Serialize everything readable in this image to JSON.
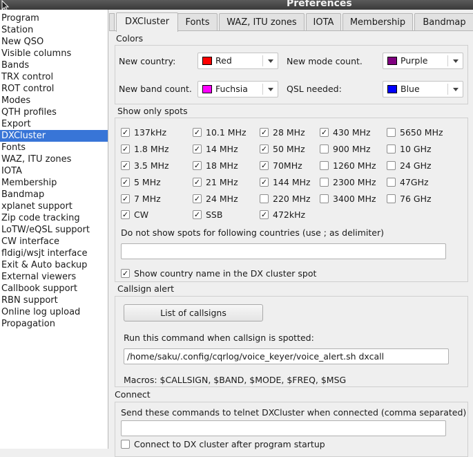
{
  "window": {
    "title": "Preferences"
  },
  "sidebar": {
    "selected": "DXCluster",
    "items": [
      "Program",
      "Station",
      "New QSO",
      "Visible columns",
      "Bands",
      "TRX control",
      "ROT control",
      "Modes",
      "QTH profiles",
      "Export",
      "DXCluster",
      "Fonts",
      "WAZ, ITU zones",
      "IOTA",
      "Membership",
      "Bandmap",
      "xplanet support",
      "Zip code tracking",
      "LoTW/eQSL support",
      "CW interface",
      "fldigi/wsjt interface",
      "Exit & Auto backup",
      "External viewers",
      "Callbook support",
      "RBN support",
      "Online log upload",
      "Propagation"
    ]
  },
  "tabs": [
    "DXCluster",
    "Fonts",
    "WAZ, ITU zones",
    "IOTA",
    "Membership",
    "Bandmap"
  ],
  "colors": {
    "heading": "Colors",
    "new_country": {
      "label": "New country:",
      "value": "Red",
      "swatch": "#ff0000"
    },
    "new_mode": {
      "label": "New mode count.",
      "value": "Purple",
      "swatch": "#800080"
    },
    "new_band": {
      "label": "New band count.",
      "value": "Fuchsia",
      "swatch": "#ff00ff"
    },
    "qsl_needed": {
      "label": "QSL needed:",
      "value": "Blue",
      "swatch": "#0000ff"
    }
  },
  "spots": {
    "heading": "Show only spots",
    "columns": [
      [
        {
          "label": "137kHz",
          "checked": true
        },
        {
          "label": "1.8 MHz",
          "checked": true
        },
        {
          "label": "3.5 MHz",
          "checked": true
        },
        {
          "label": "5 MHz",
          "checked": true
        },
        {
          "label": "7 MHz",
          "checked": true
        },
        {
          "label": "CW",
          "checked": true
        }
      ],
      [
        {
          "label": "10.1 MHz",
          "checked": true
        },
        {
          "label": "14 MHz",
          "checked": true
        },
        {
          "label": "18 MHz",
          "checked": true
        },
        {
          "label": "21 MHz",
          "checked": true
        },
        {
          "label": "24 MHz",
          "checked": true
        },
        {
          "label": "SSB",
          "checked": true
        }
      ],
      [
        {
          "label": "28 MHz",
          "checked": true
        },
        {
          "label": "50 MHz",
          "checked": true
        },
        {
          "label": "70MHz",
          "checked": true
        },
        {
          "label": "144 MHz",
          "checked": true
        },
        {
          "label": "220 MHz",
          "checked": false
        },
        {
          "label": "472kHz",
          "checked": true
        }
      ],
      [
        {
          "label": "430 MHz",
          "checked": true
        },
        {
          "label": "900 MHz",
          "checked": false
        },
        {
          "label": "1260 MHz",
          "checked": false
        },
        {
          "label": "2300 MHz",
          "checked": false
        },
        {
          "label": "3400 MHz",
          "checked": false
        }
      ],
      [
        {
          "label": "5650 MHz",
          "checked": false
        },
        {
          "label": "10 GHz",
          "checked": false
        },
        {
          "label": "24 GHz",
          "checked": false
        },
        {
          "label": "47GHz",
          "checked": false
        },
        {
          "label": "76 GHz",
          "checked": false
        }
      ]
    ],
    "exclude_label": "Do not show spots for following countries (use ; as delimiter)",
    "exclude_value": "",
    "show_country": {
      "label": "Show country name in the DX cluster spot",
      "checked": true
    }
  },
  "callsign_alert": {
    "heading": "Callsign alert",
    "button": "List of callsigns",
    "command_label": "Run this command when callsign is spotted:",
    "command_value": "/home/saku/.config/cqrlog/voice_keyer/voice_alert.sh dxcall",
    "macros": "Macros: $CALLSIGN, $BAND, $MODE, $FREQ, $MSG"
  },
  "connect": {
    "heading": "Connect",
    "commands_label": "Send these commands to telnet DXCluster when connected (comma separated)",
    "commands_value": "",
    "startup": {
      "label": "Connect to DX cluster after program startup",
      "checked": false
    }
  }
}
